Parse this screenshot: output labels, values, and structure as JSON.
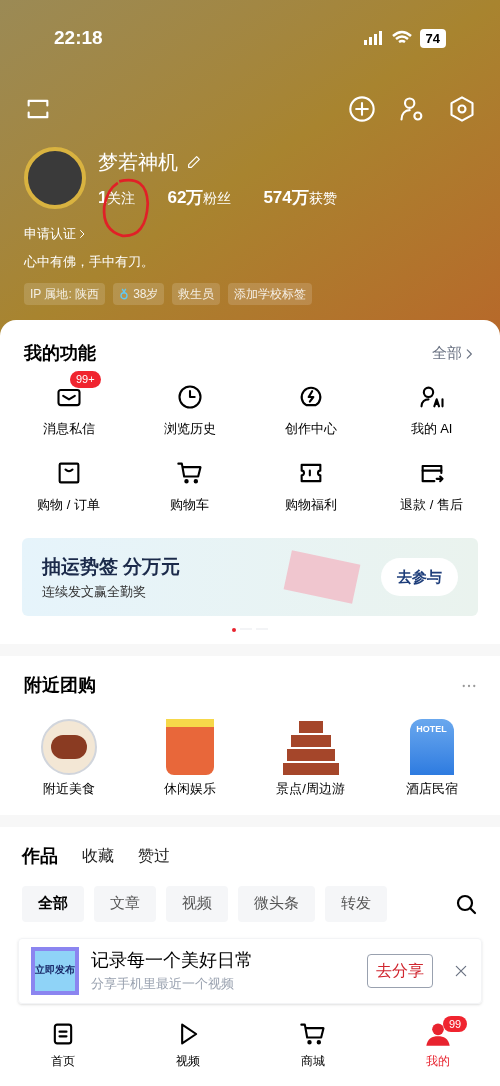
{
  "status_bar": {
    "time": "22:18",
    "battery": "74"
  },
  "profile": {
    "name": "梦若神机",
    "stats": [
      {
        "value": "1",
        "label": "关注"
      },
      {
        "value": "62万",
        "label": "粉丝"
      },
      {
        "value": "574万",
        "label": "获赞"
      }
    ],
    "verify_link": "申请认证",
    "bio": "心中有佛，手中有刀。",
    "tags": [
      {
        "kind": "plain",
        "text": "IP 属地: 陕西"
      },
      {
        "kind": "gender",
        "text": "38岁"
      },
      {
        "kind": "plain",
        "text": "救生员"
      },
      {
        "kind": "plain",
        "text": "添加学校标签"
      }
    ]
  },
  "functions": {
    "title": "我的功能",
    "more": "全部",
    "items": [
      {
        "label": "消息私信",
        "badge": "99+"
      },
      {
        "label": "浏览历史"
      },
      {
        "label": "创作中心"
      },
      {
        "label": "我的 AI"
      },
      {
        "label": "购物 / 订单"
      },
      {
        "label": "购物车"
      },
      {
        "label": "购物福利"
      },
      {
        "label": "退款 / 售后"
      }
    ]
  },
  "banner": {
    "title": "抽运势签 分万元",
    "subtitle": "连续发文赢全勤奖",
    "button": "去参与",
    "pages": [
      {
        "selected": true
      },
      {
        "selected": false
      },
      {
        "selected": false
      }
    ]
  },
  "nearby": {
    "title": "附近团购",
    "items": [
      {
        "kind": "food",
        "label": "附近美食"
      },
      {
        "kind": "drink",
        "label": "休闲娱乐"
      },
      {
        "kind": "tower",
        "label": "景点/周边游"
      },
      {
        "kind": "hotel",
        "label": "酒店民宿",
        "sign": "HOTEL"
      }
    ]
  },
  "content_tabs": [
    {
      "label": "作品",
      "selected": true
    },
    {
      "label": "收藏",
      "selected": false
    },
    {
      "label": "赞过",
      "selected": false
    }
  ],
  "filters": [
    {
      "label": "全部",
      "selected": true
    },
    {
      "label": "文章",
      "selected": false
    },
    {
      "label": "视频",
      "selected": false
    },
    {
      "label": "微头条",
      "selected": false
    },
    {
      "label": "转发",
      "selected": false
    }
  ],
  "share_card": {
    "sticker": "立即发布",
    "title": "记录每一个美好日常",
    "subtitle": "分享手机里最近一个视频",
    "button": "去分享"
  },
  "bottom_nav": [
    {
      "label": "首页",
      "selected": false
    },
    {
      "label": "视频",
      "selected": false
    },
    {
      "label": "商城",
      "selected": false
    },
    {
      "label": "我的",
      "selected": true,
      "badge": "99"
    }
  ]
}
